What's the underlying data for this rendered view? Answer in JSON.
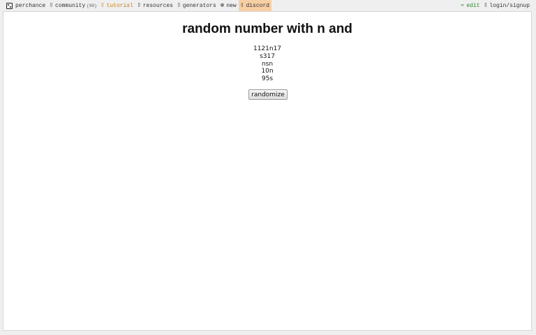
{
  "topbar": {
    "left": [
      {
        "name": "nav-perchance",
        "label": "perchance",
        "icon": "dice-icon"
      },
      {
        "name": "nav-community",
        "label": "community",
        "count": "(90)",
        "icon": "chat-icon"
      },
      {
        "name": "nav-tutorial",
        "label": "tutorial",
        "icon": "book-icon"
      },
      {
        "name": "nav-resources",
        "label": "resources",
        "icon": "box-icon"
      },
      {
        "name": "nav-generators",
        "label": "generators",
        "icon": "list-icon"
      },
      {
        "name": "nav-new",
        "label": "new",
        "icon": "plus-circle-icon"
      },
      {
        "name": "nav-discord",
        "label": "discord",
        "icon": "discord-icon"
      }
    ],
    "right": [
      {
        "name": "nav-edit",
        "label": "edit",
        "icon": "pencil-icon"
      },
      {
        "name": "nav-login",
        "label": "login/signup",
        "icon": "user-icon"
      }
    ]
  },
  "main": {
    "title": "random number with n and",
    "results": [
      "1121n17",
      "s317",
      "nsn",
      "10n",
      "95s"
    ],
    "randomize_label": "randomize"
  },
  "colors": {
    "tutorial": "#c8821a",
    "discord_bg": "#f8cfa4",
    "edit": "#2e8b2e",
    "page_bg": "#efefef",
    "panel_bg": "#ffffff"
  }
}
